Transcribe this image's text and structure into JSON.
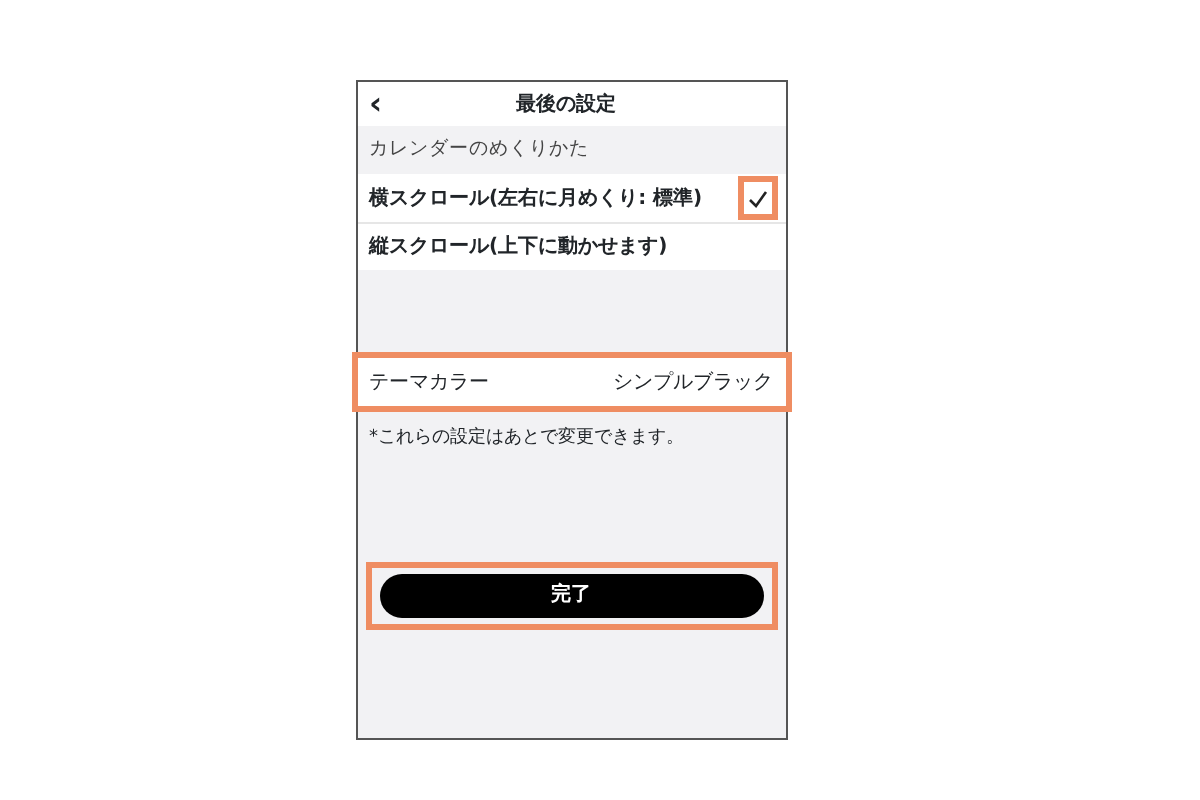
{
  "header": {
    "back_icon": "‹",
    "title": "最後の設定"
  },
  "sections": [
    {
      "label": "カレンダーのめくりかた",
      "options": [
        {
          "label": "横スクロール(左右に月めくり: 標準)",
          "selected": true,
          "highlighted": true
        },
        {
          "label": "縦スクロール(上下に動かせます)",
          "selected": false,
          "highlighted": false
        }
      ]
    }
  ],
  "theme": {
    "label": "テーマカラー",
    "value": "シンプルブラック",
    "highlighted": true
  },
  "note": "*これらの設定はあとで変更できます。",
  "done_button": {
    "label": "完了",
    "highlighted": true
  }
}
